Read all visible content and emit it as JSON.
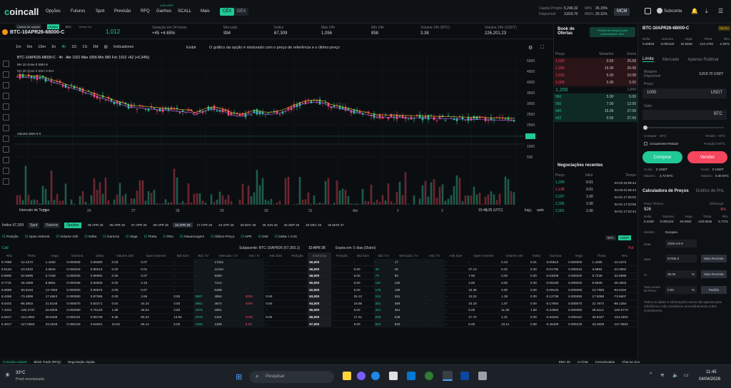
{
  "app": {
    "logo_prefix": "c",
    "logo_rest": "oincall"
  },
  "nav": {
    "items": [
      "Opções",
      "Futuros",
      "Spot",
      "Previsão",
      "RFQ",
      "Ganhos",
      "SCALL",
      "Mais"
    ],
    "ganhos_badge": "4,5% APR",
    "cex": "CEX",
    "dex": "DEX"
  },
  "account": {
    "capital_label": "Capital Próprio",
    "capital": "5,246.32",
    "disp_label": "Disponível",
    "disp": "3,819.70",
    "im_label": "IM%",
    "im": "26.15%",
    "mm_label": "MM%",
    "mm": "20.11%",
    "mcm": "MCM",
    "subconta": "Subconta"
  },
  "ticker": {
    "symbol": "BTC-10APR26-68000-C",
    "price": "1,012",
    "tabs": [
      "Cadeia de opções",
      "Gráfico",
      "BTC",
      "Venha Ver"
    ],
    "stats": [
      {
        "l": "Variação em 24 horas",
        "v": "+45 +4.65%"
      },
      {
        "l": "Mercado",
        "v": "994"
      },
      {
        "l": "Índice",
        "v": "67,309"
      },
      {
        "l": "Máx 24h",
        "v": "1,056"
      },
      {
        "l": "Mín 24h",
        "v": "858"
      },
      {
        "l": "Volume 24h (BTC)",
        "v": "3.38"
      },
      {
        "l": "Volume 24h (USDT)",
        "v": "226,201.23"
      }
    ]
  },
  "chart": {
    "timeframes": [
      "1m",
      "5m",
      "15m",
      "1h",
      "4h",
      "1D",
      "1S",
      "1M"
    ],
    "indicators": "Indicadores",
    "exibir": "Exibir",
    "notice": "O gráfico da opção é misturado com o preço de referência e o último preço",
    "ohlc": "BTC-10APR26-68000-C · 4h · Abr 1021 Máx 1056 Mín 950 Fch 1012 +62 (+6.34%)",
    "ma10": "MA 10 close 0 SMA 9",
    "ma20": "MA 20 close 0 SMA 9  914",
    "volume": "Volume SMA 9  0",
    "xticks": [
      "25",
      "26",
      "27",
      "28",
      "29",
      "30",
      "31",
      "Abr",
      "2",
      "3",
      "4",
      "5"
    ],
    "yticks": [
      "5000",
      "4500",
      "4000",
      "3500",
      "3000",
      "2500",
      "2000",
      "1500",
      "1000",
      "500"
    ],
    "time": "15:45:35 (UTC)",
    "log": "log",
    "auto": "auto",
    "interval": "Intervalo de Tempo"
  },
  "book": {
    "title": "Book de Ofertas",
    "btn": "Pedido de cotação para profundidade 180x",
    "cols": [
      "Preço",
      "Tamanho",
      "Soma"
    ],
    "asks": [
      [
        "1,020",
        "0.50",
        "25.58"
      ],
      [
        "1,200",
        "15.00",
        "26.08"
      ],
      [
        "1,010",
        "5.00",
        "10.08"
      ],
      [
        "1,000",
        "5.00",
        "5.00"
      ]
    ],
    "mid": "1,200",
    "mid_extra": "1,000",
    "bids": [
      [
        "960",
        "5.00",
        "5.00"
      ],
      [
        "950",
        "7.00",
        "12.00"
      ],
      [
        "940",
        "15.09",
        "27.09"
      ],
      [
        "422",
        "0.50",
        "27.59"
      ]
    ],
    "recent_title": "Negociações recentes",
    "recent_cols": [
      "Preço",
      "Valor",
      "Tempo"
    ],
    "recent": [
      [
        "1,200",
        "0.01",
        "04-03 04:09:44"
      ],
      [
        "1,198",
        "0.01",
        "04-03 01:08:44"
      ],
      [
        "2,207",
        "1.00",
        "04-01 17:25:02"
      ],
      [
        "2,395",
        "1.00",
        "04-01 17:23:56"
      ],
      [
        "2,391",
        "1.00",
        "04-01 17:22:44"
      ]
    ]
  },
  "trade": {
    "symbol": "BTC-10APR26-68000-C",
    "badge": "Op.Eu",
    "greek_labels": [
      "Delta",
      "Gamma",
      "Vega",
      "Theta",
      "Rho"
    ],
    "greeks": [
      "0.40533",
      "0.000120",
      "32.6948",
      "-113.1702",
      "4.2972"
    ],
    "tabs": [
      "Limite",
      "Mercado",
      "Apenas Publicar"
    ],
    "margin_label": "Margem Disponível",
    "margin": "3,819.70 USDT",
    "price_label": "Preço",
    "price": "1000",
    "price_unit": "USDT",
    "value_label": "Valor",
    "value_unit": "BTC",
    "buy_max": "Comprar – BTC",
    "sell_max": "Vender – BTC",
    "reduce": "Unicamente Reduzir",
    "position": "Posição 0 BTC",
    "buy": "Comprar",
    "sell": "Vender",
    "cost_label": "Custo",
    "cost": "0 USDT",
    "max_label": "Máximo",
    "max": "2.72 BTC",
    "cost2": "0 USDT",
    "max2": "0.36 BTC"
  },
  "calc": {
    "tabs": [
      "Calculadora de Preços",
      "Gráfico de PnL"
    ],
    "theo_label": "Preço Teórico",
    "theo": "926",
    "diff_label": "Diferença",
    "diff": "-8%",
    "greek_vals": [
      "0.4228",
      "0.000120",
      "30.8453",
      "-120.5045",
      "5.7721"
    ],
    "model_label": "Modelo",
    "model": "Europeu",
    "date_label": "Data",
    "date": "2026-4-6",
    "spot_label": "Spot",
    "spot": "67336.3",
    "iv_label": "IV",
    "iv": "39.06",
    "rate_label": "Taxa Isenta de Risco",
    "rate": "0.03",
    "recent_btn": "Mais Recente",
    "default_btn": "Padrão",
    "note": "Todos os dados e informações acima são apenas para referência e não constituem aconselhamento sobre investimento."
  },
  "chain": {
    "index": "Índice 67,309",
    "tabs": [
      "Spot",
      "Futuros",
      "Opções"
    ],
    "dates": [
      "05 APR 26",
      "06 APR 26",
      "07 APR 26",
      "08 APR 26",
      "10 APR 26",
      "17 APR 26",
      "24 APR 26",
      "29 MAY 26",
      "26 JUN 26",
      "25 SEP 26",
      "25 DEC 26",
      "26 MAR 27"
    ],
    "checks": [
      "Posição",
      "Open Interest",
      "Volume 24h",
      "Delta",
      "Gamma",
      "Vega",
      "Theta",
      "Rho",
      "Alavancagem",
      "Último Preço",
      "APR",
      "Dist",
      "Delta < 0.01"
    ],
    "btc": "BTC",
    "usdt": "USDT",
    "call": "Call",
    "put": "Put",
    "underlying": "Subjacente: BTC-10APR26 (67,303.1)",
    "date": "10 APR 26",
    "expiry": "Expira em: 5 dias (Diário)",
    "headers": [
      "Rho",
      "Theta",
      "Vega",
      "Gamma",
      "Delta",
      "Volume 24h",
      "Open Interest",
      "Bid Size",
      "Bid / IV",
      "Mercado / IV",
      "Ask / IV",
      "Ask Size",
      "Posição",
      "Exercício",
      "Posição",
      "Bid Size",
      "Bid / IV",
      "Mercado / IV",
      "Ask / IV",
      "Ask Size",
      "Open Interest",
      "Volume 24h",
      "Delta",
      "Gamma",
      "Vega",
      "Theta",
      "Rho"
    ],
    "rows": [
      [
        "8.7099",
        "-12.4372",
        "1.4460",
        "0.000009",
        "0.99390",
        "0.03",
        "0.07",
        "-",
        "-",
        "17321",
        "-",
        "-",
        "",
        "50,000",
        "",
        "-",
        "-",
        "17",
        "-",
        "-",
        "-",
        "0.23",
        "0.01",
        "-0.00610",
        "0.000000",
        "1.4480",
        "-12.4372",
        "-0.0664"
      ],
      [
        "8.5162",
        "-23.3332",
        "3.6916",
        "0.000018",
        "0.98214",
        "0.00",
        "0.01",
        "-",
        "-",
        "11344",
        "-",
        "-",
        "",
        "56,000",
        "",
        "5.00",
        "30",
        "40",
        "-",
        "-",
        "27.13",
        "0.02",
        "0.00",
        "-0.01785",
        "0.000016",
        "3.6894",
        "-23.3862",
        "-0.1712"
      ],
      [
        "8.6955",
        "-32.6995",
        "5.7239",
        "0.000029",
        "0.96992",
        "0.00",
        "0.07",
        "-",
        "-",
        "9369",
        "-",
        "-",
        "",
        "58,000",
        "",
        "5.00",
        "70",
        "80",
        "-",
        "-",
        "7.50",
        "0.00",
        "0.00",
        "-0.03008",
        "0.000020",
        "5.7239",
        "-32.6995",
        "-0.3250"
      ],
      [
        "8.7731",
        "-45.3289",
        "8.8961",
        "0.000039",
        "0.94836",
        "0.00",
        "0.15",
        "-",
        "-",
        "7412",
        "-",
        "-",
        "",
        "60,000",
        "",
        "5.00",
        "110",
        "120",
        "-",
        "-",
        "4.60",
        "0.00",
        "0.00",
        "-0.05180",
        "0.000020",
        "8.9029",
        "-45.3843",
        "-0.5591"
      ],
      [
        "8.6688",
        "-63.8184",
        "13.7693",
        "0.000060",
        "0.90876",
        "0.00",
        "0.07",
        "-",
        "-",
        "5488",
        "-",
        "-",
        "",
        "62,000",
        "",
        "5.00",
        "170",
        "185",
        "-",
        "-",
        "16.36",
        "0.00",
        "0.00",
        "-0.09120",
        "0.000060",
        "13.7693",
        "-63.8184",
        "-0.9845"
      ],
      [
        "8.4268",
        "-73.4899",
        "17.4843",
        "0.000060",
        "0.87385",
        "0.00",
        "3.66",
        "0.50",
        "3887",
        "4564",
        "5005",
        "0.50",
        "",
        "63,000",
        "",
        "25.12",
        "241",
        "261",
        "-",
        "-",
        "10.22",
        "1.28",
        "0.00",
        "-0.12738",
        "0.000050",
        "17.5068",
        "-73.6607",
        "-1.3740"
      ],
      [
        "8.0402",
        "-86.3602",
        "21.8148",
        "0.000070",
        "0.82271",
        "0.04",
        "24.24",
        "0.50",
        "3862",
        "3674",
        "4005",
        "0.50",
        "",
        "64,000",
        "",
        "18.95",
        "301",
        "369",
        "-",
        "-",
        "43.18",
        "1.07",
        "0.00",
        "-0.17694",
        "0.000070",
        "21.7874",
        "-86.1354",
        "-1.9096"
      ],
      [
        "7.4204",
        "-100.3737",
        "26.6009",
        "0.000090",
        "0.75126",
        "1.69",
        "39.64",
        "0.50",
        "1876",
        "2851",
        "-",
        "-",
        "",
        "65,000",
        "",
        "5.00",
        "421",
        "451",
        "-",
        "-",
        "5.00",
        "11.06",
        "1.58",
        "-0.24893",
        "0.000090",
        "26.6114",
        "-100.5772",
        "-2.6909"
      ],
      [
        "6.5517",
        "-113.1992",
        "30.8436",
        "0.000110",
        "0.65739",
        "6.36",
        "60.24",
        "13.84",
        "2079",
        "2119",
        "2130",
        "5.00",
        "",
        "66,000",
        "",
        "17.41",
        "540",
        "548",
        "-",
        "-",
        "17.72",
        "1.31",
        "0.00",
        "-0.34264",
        "0.000110",
        "30.8447",
        "-113.2302",
        "-3.7134"
      ],
      [
        "5.4917",
        "-117.0663",
        "33.2628",
        "0.000120",
        "0.54591",
        "10.52",
        "66.14",
        "5.00",
        "1455",
        "1495",
        "5.00",
        "-",
        "",
        "67,000",
        "",
        "5.00",
        "816",
        "820",
        "-",
        "-",
        "5.00",
        "19.11",
        "0.98",
        "-0.45409",
        "0.000120",
        "33.2628",
        "-117.0663",
        "-4.9386"
      ]
    ]
  },
  "status": {
    "stable": "Conexão estável",
    "block": "Block Trade (RFQ)",
    "quick": "Negociação rápida",
    "ddh": "DDH 25",
    "ai": "AI Chat",
    "comms": "Comunicados",
    "chat": "Chat ao vivo"
  },
  "taskbar": {
    "temp": "33°C",
    "weather": "Pred ensolarado",
    "search": "Pesquisar",
    "time": "11:45",
    "date": "04/04/2026"
  }
}
